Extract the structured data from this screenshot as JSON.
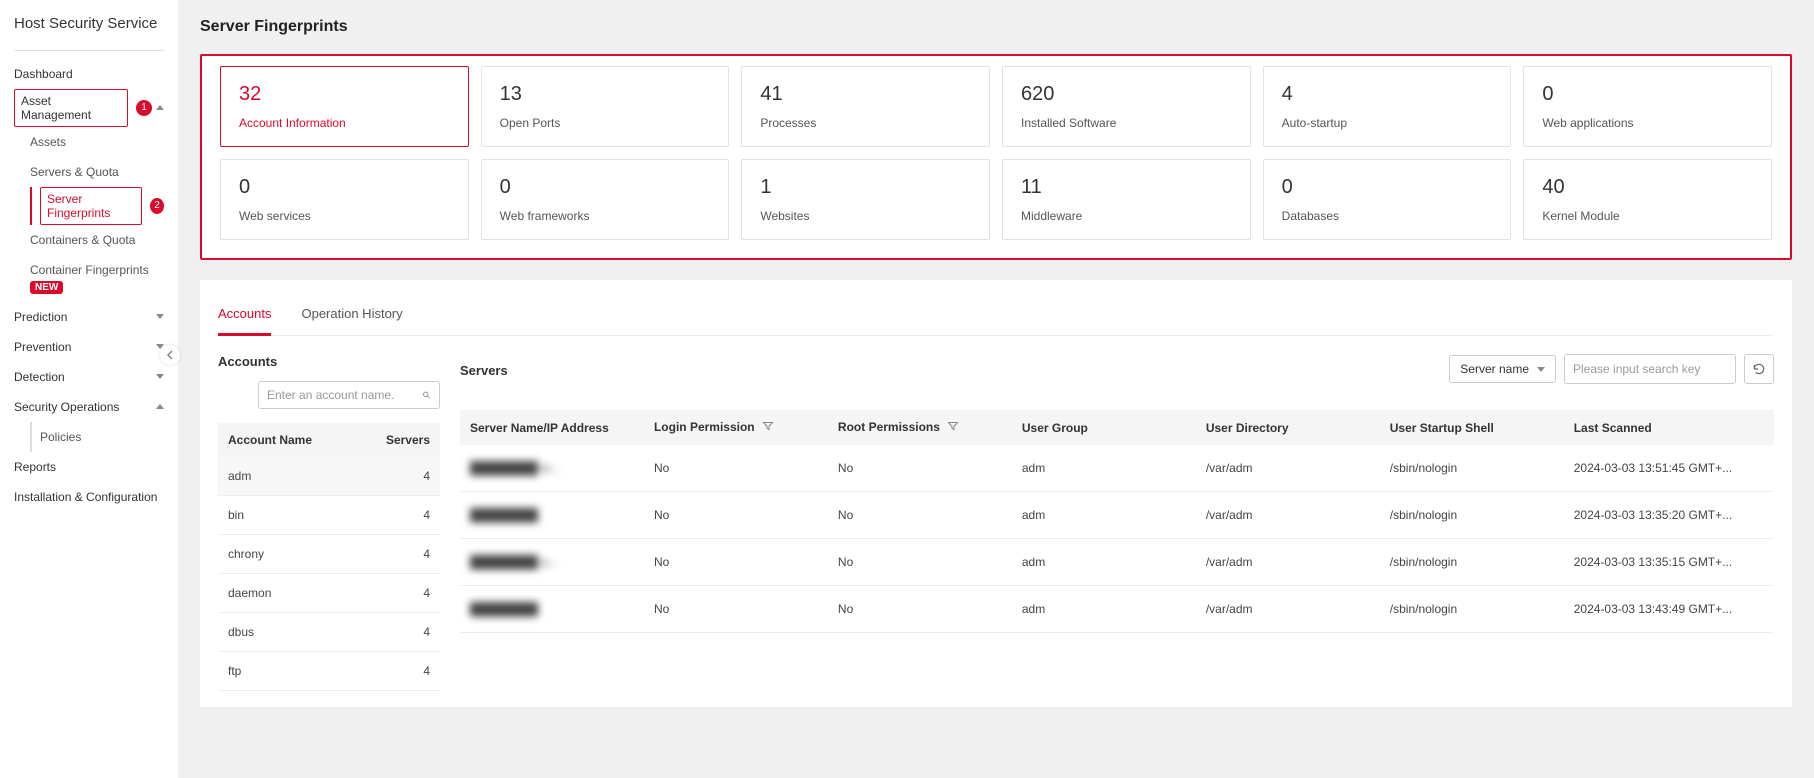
{
  "app_title": "Host Security Service",
  "nav": {
    "dashboard": "Dashboard",
    "asset_management": "Asset Management",
    "assets": "Assets",
    "servers_quota": "Servers & Quota",
    "server_fingerprints": "Server Fingerprints",
    "containers_quota": "Containers & Quota",
    "container_fingerprints": "Container Fingerprints",
    "new_badge": "NEW",
    "prediction": "Prediction",
    "prevention": "Prevention",
    "detection": "Detection",
    "security_operations": "Security Operations",
    "policies": "Policies",
    "reports": "Reports",
    "installation_config": "Installation & Configuration",
    "marker1": "1",
    "marker2": "2"
  },
  "page_title": "Server Fingerprints",
  "cards": [
    {
      "num": "32",
      "label": "Account Information",
      "active": true
    },
    {
      "num": "13",
      "label": "Open Ports"
    },
    {
      "num": "41",
      "label": "Processes"
    },
    {
      "num": "620",
      "label": "Installed Software"
    },
    {
      "num": "4",
      "label": "Auto-startup"
    },
    {
      "num": "0",
      "label": "Web applications"
    },
    {
      "num": "0",
      "label": "Web services"
    },
    {
      "num": "0",
      "label": "Web frameworks"
    },
    {
      "num": "1",
      "label": "Websites"
    },
    {
      "num": "11",
      "label": "Middleware"
    },
    {
      "num": "0",
      "label": "Databases"
    },
    {
      "num": "40",
      "label": "Kernel Module"
    }
  ],
  "tabs": {
    "accounts": "Accounts",
    "operation_history": "Operation History"
  },
  "accounts_panel": {
    "heading": "Accounts",
    "search_placeholder": "Enter an account name.",
    "cols": {
      "name": "Account Name",
      "servers": "Servers"
    },
    "rows": [
      {
        "name": "adm",
        "servers": "4"
      },
      {
        "name": "bin",
        "servers": "4"
      },
      {
        "name": "chrony",
        "servers": "4"
      },
      {
        "name": "daemon",
        "servers": "4"
      },
      {
        "name": "dbus",
        "servers": "4"
      },
      {
        "name": "ftp",
        "servers": "4"
      }
    ]
  },
  "servers_panel": {
    "heading": "Servers",
    "filter_select": "Server name",
    "search_placeholder": "Please input search key",
    "cols": {
      "server_name": "Server Name/IP Address",
      "login_permission": "Login Permission",
      "root_permissions": "Root Permissions",
      "user_group": "User Group",
      "user_directory": "User Directory",
      "user_startup_shell": "User Startup Shell",
      "last_scanned": "Last Scanned"
    },
    "rows": [
      {
        "server": "████████ w...",
        "login": "No",
        "root": "No",
        "group": "adm",
        "dir": "/var/adm",
        "shell": "/sbin/nologin",
        "scanned": "2024-03-03 13:51:45 GMT+..."
      },
      {
        "server": "████████",
        "login": "No",
        "root": "No",
        "group": "adm",
        "dir": "/var/adm",
        "shell": "/sbin/nologin",
        "scanned": "2024-03-03 13:35:20 GMT+..."
      },
      {
        "server": "████████ a...",
        "login": "No",
        "root": "No",
        "group": "adm",
        "dir": "/var/adm",
        "shell": "/sbin/nologin",
        "scanned": "2024-03-03 13:35:15 GMT+..."
      },
      {
        "server": "████████",
        "login": "No",
        "root": "No",
        "group": "adm",
        "dir": "/var/adm",
        "shell": "/sbin/nologin",
        "scanned": "2024-03-03 13:43:49 GMT+..."
      }
    ]
  },
  "misc": {
    "no": "No"
  }
}
